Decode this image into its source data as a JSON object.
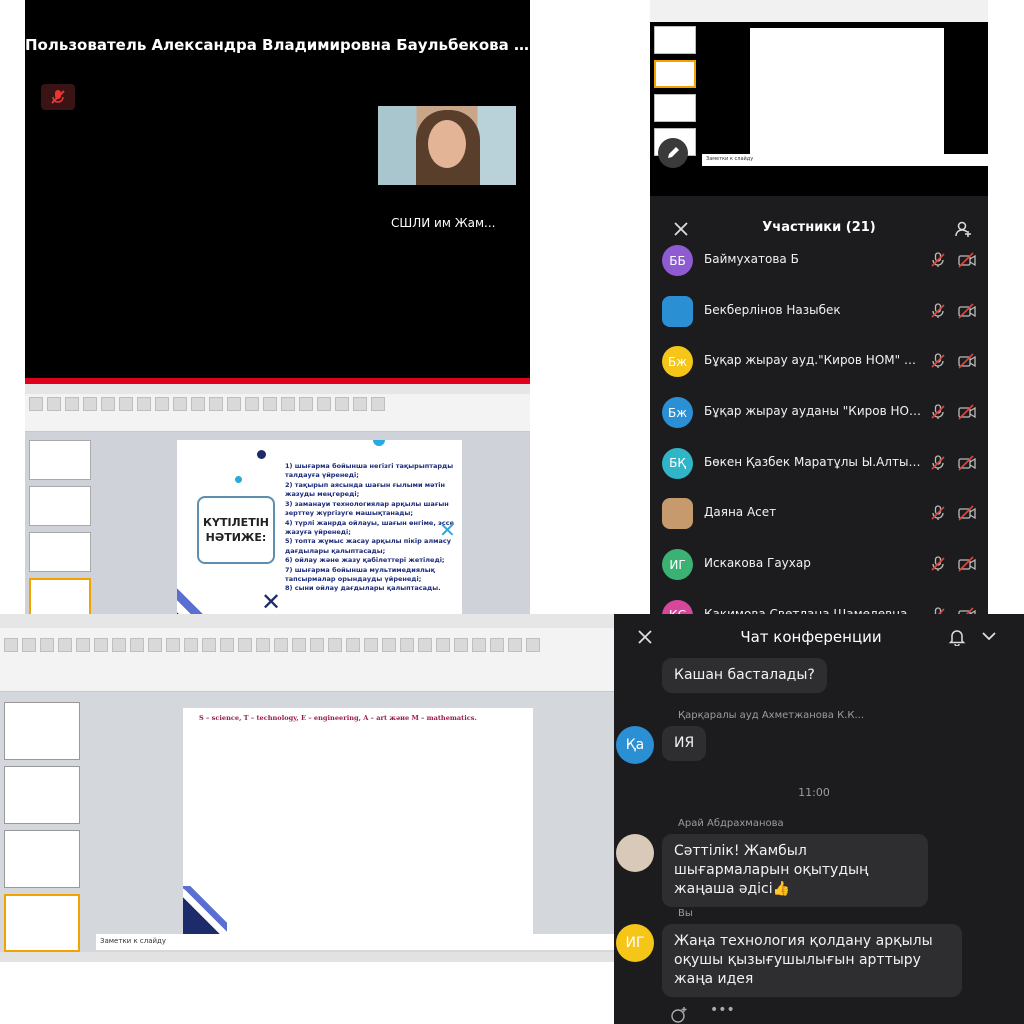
{
  "video_call": {
    "join_notice": "Пользователь Александра Владимировна Баульбекова подклю...",
    "camera_label": "СШЛИ им Жам..."
  },
  "slide_left": {
    "box_title": "КҮТІЛЕТІН НӘТИЖЕ:",
    "items": [
      "1) шығарма бойынша негізгі тақырыптарды талдауға үйренеді;",
      "2) тақырып аясында шағын ғылыми мәтін жазуды меңгереді;",
      "3) заманауи технологиялар арқылы шағын зерттеу жүргізуге машықтанады;",
      "4) түрлі жанрда ойлауы, шағын өнгіме, эссе жазуға үйренеді;",
      "5) топта жұмыс жасау арқылы пікір алмасу дағдылары қалыптасады;",
      "6) ойлау және жазу қабілеттері жетіледі;",
      "7) шығарма бойынша мультимедиялық тапсырмалар орындауды үйренеді;",
      "8) сыни ойлау дағдылары қалыптасады."
    ]
  },
  "participants": {
    "title": "Участники (21)",
    "list": [
      {
        "initials": "ББ",
        "name": "Баймухатова Б",
        "color": "#8e5bd1",
        "photo": false
      },
      {
        "initials": "",
        "name": "Бекберлінов Назыбек",
        "color": "#2b8fd4",
        "photo": true
      },
      {
        "initials": "Бж",
        "name": "Бұқар жырау ауд.\"Киров НОМ\" Ба...",
        "color": "#f5c518",
        "photo": false
      },
      {
        "initials": "Бж",
        "name": "Бұқар жырау ауданы \"Киров НОМ...",
        "color": "#2b8fd4",
        "photo": false
      },
      {
        "initials": "БҚ",
        "name": "Бөкен Қазбек Маратұлы Ы.Алтын...",
        "color": "#30b5c8",
        "photo": false
      },
      {
        "initials": "",
        "name": "Даяна Асет",
        "color": "#c79a6e",
        "photo": true
      },
      {
        "initials": "ИГ",
        "name": "Искакова Гаухар",
        "color": "#3bb273",
        "photo": false
      },
      {
        "initials": "КС",
        "name": "Какимова Светлана Шамелевна",
        "color": "#d6479a",
        "photo": false
      }
    ]
  },
  "slide_main": {
    "heading": "S – science, T – technology, E – engineering, A – art және M – mathematics.",
    "notes": "Заметки к слайду"
  },
  "chat": {
    "title": "Чат конференции",
    "msg1": "Кашан басталады?",
    "sender2": "Қарқаралы ауд Ахметжанова К.К...",
    "avatar2": "Қа",
    "msg2": "ИЯ",
    "time": "11:00",
    "sender3": "Арай Абдрахманова",
    "msg3": "Сәттілік! Жамбыл шығармаларын оқытудың жаңаша әдісі👍",
    "sender4": "Вы",
    "avatar4": "ИГ",
    "msg4": "Жаңа технология қолдану арқылы оқушы қызығушылығын арттыру жаңа идея"
  }
}
